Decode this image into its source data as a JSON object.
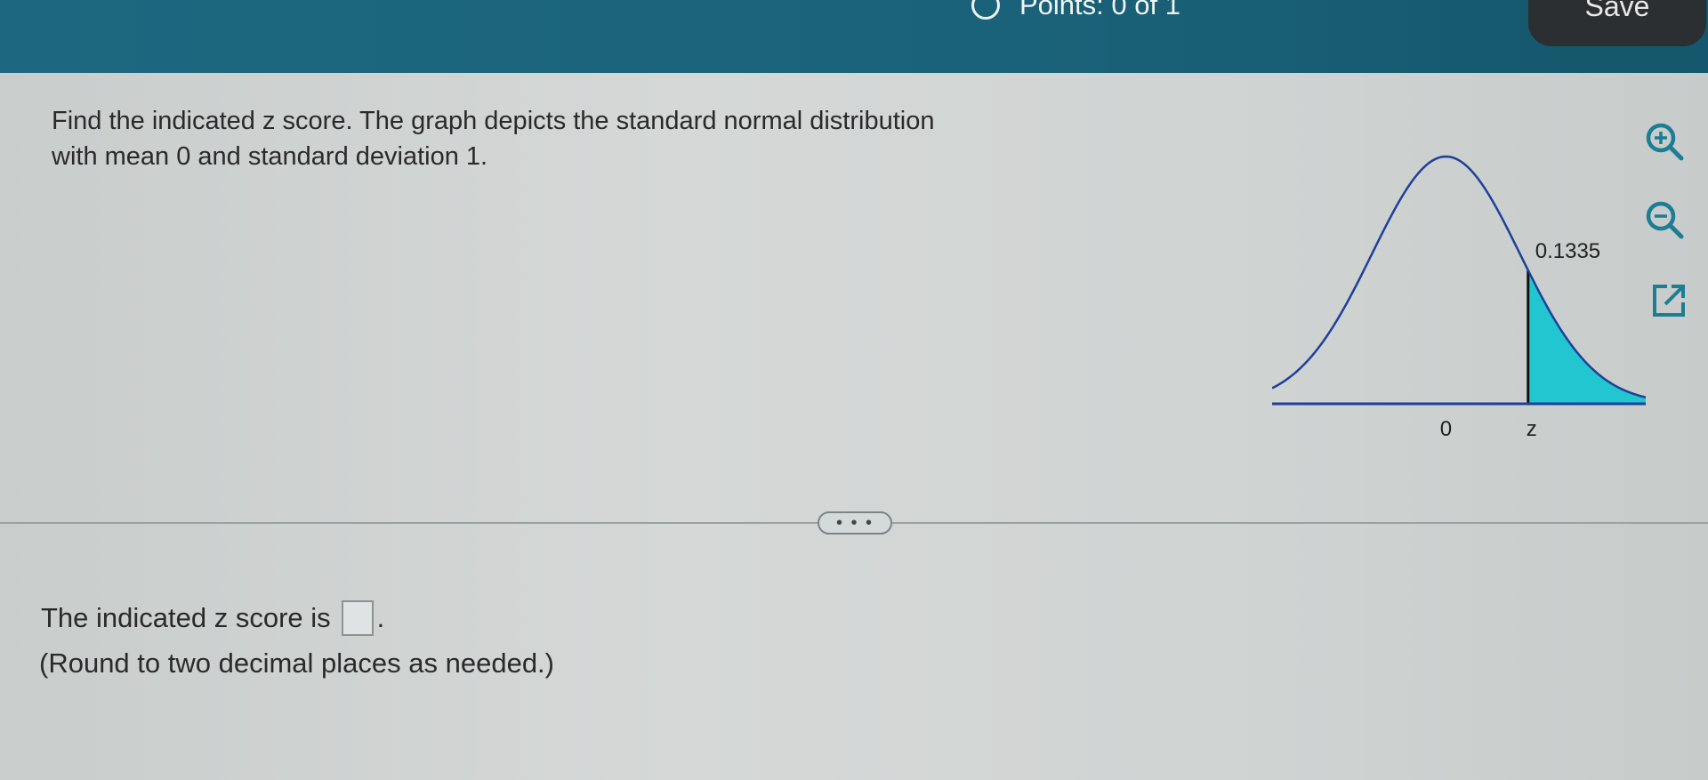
{
  "header": {
    "points_label": "Points: 0 of 1",
    "save_label": "Save"
  },
  "question": {
    "line1": "Find the indicated z score. The graph depicts the standard normal distribution",
    "line2": "with mean 0 and standard deviation 1."
  },
  "graph": {
    "area_label": "0.1335",
    "mean_label": "0",
    "z_label": "z",
    "shaded_tail_area": 0.1335,
    "fill_color": "#22c6d0",
    "curve_color": "#1f3f9a"
  },
  "tools": {
    "zoom_in": "zoom-in-icon",
    "zoom_out": "zoom-out-icon",
    "popout": "external-link-icon"
  },
  "divider": {
    "more_label": "• • •"
  },
  "answer": {
    "prompt": "The indicated z score is",
    "value": "",
    "suffix": ".",
    "instruction": "(Round to two decimal places as needed.)"
  },
  "colors": {
    "header_bg": "#1d6880",
    "save_bg": "#2b2f31",
    "icon_color": "#1c7d93"
  }
}
